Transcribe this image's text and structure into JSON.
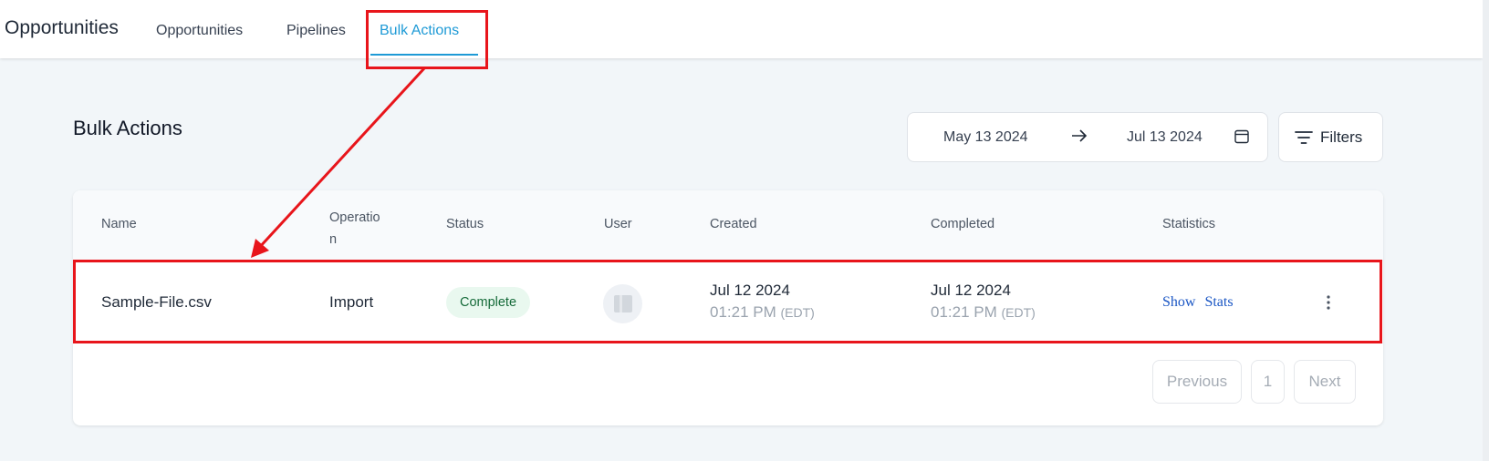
{
  "header": {
    "app_title": "Opportunities",
    "tabs": [
      {
        "label": "Opportunities",
        "active": false
      },
      {
        "label": "Pipelines",
        "active": false
      },
      {
        "label": "Bulk Actions",
        "active": true
      }
    ]
  },
  "main": {
    "heading": "Bulk Actions",
    "date_range": {
      "start": "May 13 2024",
      "end": "Jul 13 2024"
    },
    "filters_label": "Filters",
    "table": {
      "columns": [
        "Name",
        "Operatio\nn",
        "Status",
        "User",
        "Created",
        "Completed",
        "Statistics"
      ],
      "rows": [
        {
          "name": "Sample-File.csv",
          "operation": "Import",
          "status": "Complete",
          "created_date": "Jul 12 2024",
          "created_time": "01:21 PM",
          "created_tz": "(EDT)",
          "completed_date": "Jul 12 2024",
          "completed_time": "01:21 PM",
          "completed_tz": "(EDT)",
          "stats_label": "Show Stats"
        }
      ]
    },
    "pagination": {
      "previous": "Previous",
      "page": "1",
      "next": "Next"
    }
  },
  "colors": {
    "accent": "#1e9ad6",
    "status_bg": "#e9f8ef",
    "status_text": "#166b3a",
    "annotation": "#e8151b",
    "link": "#1a56c4"
  },
  "icons": {
    "arrow": "arrow-right-icon",
    "calendar": "calendar-icon",
    "filters": "filter-lines-icon",
    "more": "kebab-menu-icon",
    "avatar": "user-avatar-icon"
  }
}
